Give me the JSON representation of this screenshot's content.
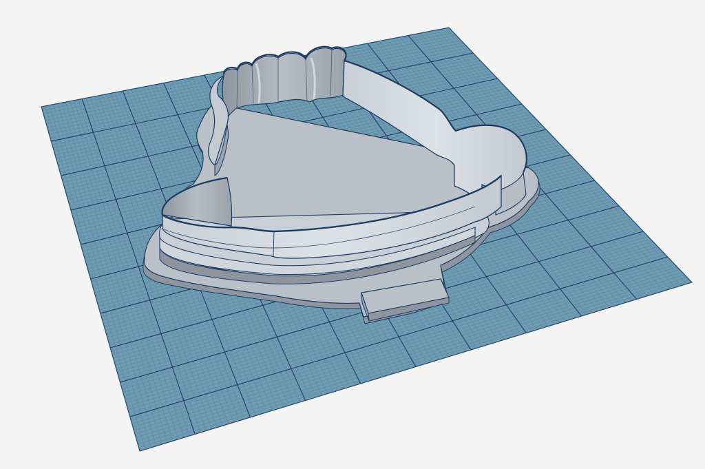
{
  "viewport": {
    "background": "#f4f4f4",
    "grid": {
      "fill": "#6f9bb2",
      "minor_line": "#4f7f9b",
      "major_line": "#1f3d66",
      "border": "#2c4f75"
    },
    "model": {
      "name": "cookie cutter",
      "fill": "#d3d8de",
      "shade": "#a9b0b8",
      "dark": "#8a929b",
      "edge": "#1d3b61"
    }
  }
}
